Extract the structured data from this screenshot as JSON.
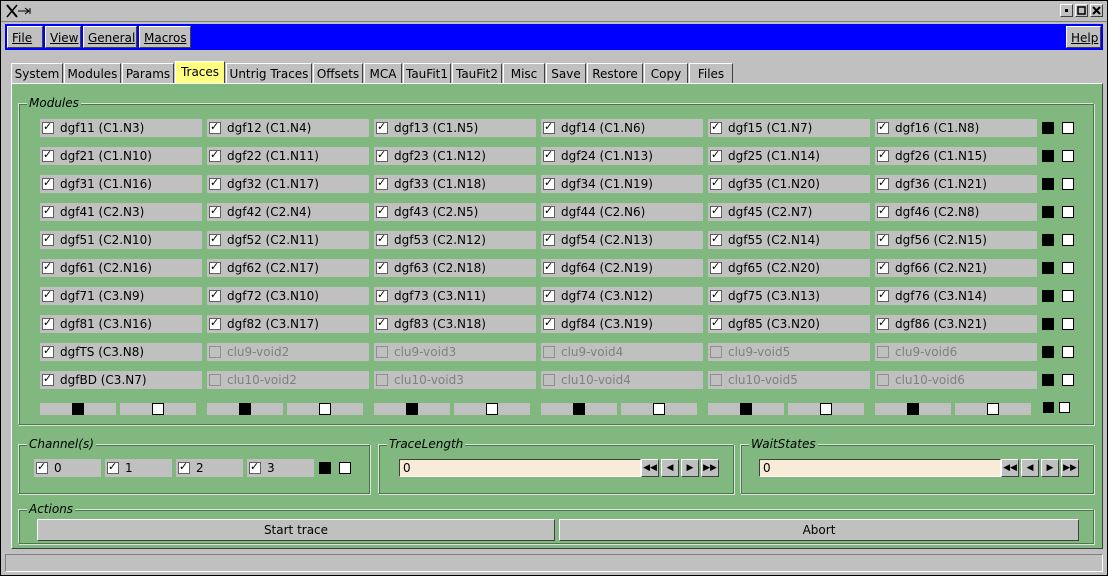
{
  "window": {
    "title_icon": "x-window-icon",
    "controls": [
      "minimize-icon",
      "maximize-icon",
      "close-icon"
    ]
  },
  "menubar": {
    "file": "File",
    "view": "View",
    "general": "General",
    "macros": "Macros",
    "help": "Help"
  },
  "tabs": [
    "System",
    "Modules",
    "Params",
    "Traces",
    "Untrig Traces",
    "Offsets",
    "MCA",
    "TauFit1",
    "TauFit2",
    "Misc",
    "Save",
    "Restore",
    "Copy",
    "Files"
  ],
  "active_tab": "Traces",
  "modules": {
    "title": "Modules",
    "rows": [
      [
        {
          "t": "dgf11 (C1.N3)",
          "c": true,
          "e": true
        },
        {
          "t": "dgf12 (C1.N4)",
          "c": true,
          "e": true
        },
        {
          "t": "dgf13 (C1.N5)",
          "c": true,
          "e": true
        },
        {
          "t": "dgf14 (C1.N6)",
          "c": true,
          "e": true
        },
        {
          "t": "dgf15 (C1.N7)",
          "c": true,
          "e": true
        },
        {
          "t": "dgf16 (C1.N8)",
          "c": true,
          "e": true
        }
      ],
      [
        {
          "t": "dgf21 (C1.N10)",
          "c": true,
          "e": true
        },
        {
          "t": "dgf22 (C1.N11)",
          "c": true,
          "e": true
        },
        {
          "t": "dgf23 (C1.N12)",
          "c": true,
          "e": true
        },
        {
          "t": "dgf24 (C1.N13)",
          "c": true,
          "e": true
        },
        {
          "t": "dgf25 (C1.N14)",
          "c": true,
          "e": true
        },
        {
          "t": "dgf26 (C1.N15)",
          "c": true,
          "e": true
        }
      ],
      [
        {
          "t": "dgf31 (C1.N16)",
          "c": true,
          "e": true
        },
        {
          "t": "dgf32 (C1.N17)",
          "c": true,
          "e": true
        },
        {
          "t": "dgf33 (C1.N18)",
          "c": true,
          "e": true
        },
        {
          "t": "dgf34 (C1.N19)",
          "c": true,
          "e": true
        },
        {
          "t": "dgf35 (C1.N20)",
          "c": true,
          "e": true
        },
        {
          "t": "dgf36 (C1.N21)",
          "c": true,
          "e": true
        }
      ],
      [
        {
          "t": "dgf41 (C2.N3)",
          "c": true,
          "e": true
        },
        {
          "t": "dgf42 (C2.N4)",
          "c": true,
          "e": true
        },
        {
          "t": "dgf43 (C2.N5)",
          "c": true,
          "e": true
        },
        {
          "t": "dgf44 (C2.N6)",
          "c": true,
          "e": true
        },
        {
          "t": "dgf45 (C2.N7)",
          "c": true,
          "e": true
        },
        {
          "t": "dgf46 (C2.N8)",
          "c": true,
          "e": true
        }
      ],
      [
        {
          "t": "dgf51 (C2.N10)",
          "c": true,
          "e": true
        },
        {
          "t": "dgf52 (C2.N11)",
          "c": true,
          "e": true
        },
        {
          "t": "dgf53 (C2.N12)",
          "c": true,
          "e": true
        },
        {
          "t": "dgf54 (C2.N13)",
          "c": true,
          "e": true
        },
        {
          "t": "dgf55 (C2.N14)",
          "c": true,
          "e": true
        },
        {
          "t": "dgf56 (C2.N15)",
          "c": true,
          "e": true
        }
      ],
      [
        {
          "t": "dgf61 (C2.N16)",
          "c": true,
          "e": true
        },
        {
          "t": "dgf62 (C2.N17)",
          "c": true,
          "e": true
        },
        {
          "t": "dgf63 (C2.N18)",
          "c": true,
          "e": true
        },
        {
          "t": "dgf64 (C2.N19)",
          "c": true,
          "e": true
        },
        {
          "t": "dgf65 (C2.N20)",
          "c": true,
          "e": true
        },
        {
          "t": "dgf66 (C2.N21)",
          "c": true,
          "e": true
        }
      ],
      [
        {
          "t": "dgf71 (C3.N9)",
          "c": true,
          "e": true
        },
        {
          "t": "dgf72 (C3.N10)",
          "c": true,
          "e": true
        },
        {
          "t": "dgf73 (C3.N11)",
          "c": true,
          "e": true
        },
        {
          "t": "dgf74 (C3.N12)",
          "c": true,
          "e": true
        },
        {
          "t": "dgf75 (C3.N13)",
          "c": true,
          "e": true
        },
        {
          "t": "dgf76 (C3.N14)",
          "c": true,
          "e": true
        }
      ],
      [
        {
          "t": "dgf81 (C3.N16)",
          "c": true,
          "e": true
        },
        {
          "t": "dgf82 (C3.N17)",
          "c": true,
          "e": true
        },
        {
          "t": "dgf83 (C3.N18)",
          "c": true,
          "e": true
        },
        {
          "t": "dgf84 (C3.N19)",
          "c": true,
          "e": true
        },
        {
          "t": "dgf85 (C3.N20)",
          "c": true,
          "e": true
        },
        {
          "t": "dgf86 (C3.N21)",
          "c": true,
          "e": true
        }
      ],
      [
        {
          "t": "dgfTS (C3.N8)",
          "c": true,
          "e": true
        },
        {
          "t": "clu9-void2",
          "c": false,
          "e": false
        },
        {
          "t": "clu9-void3",
          "c": false,
          "e": false
        },
        {
          "t": "clu9-void4",
          "c": false,
          "e": false
        },
        {
          "t": "clu9-void5",
          "c": false,
          "e": false
        },
        {
          "t": "clu9-void6",
          "c": false,
          "e": false
        }
      ],
      [
        {
          "t": "dgfBD (C3.N7)",
          "c": true,
          "e": true
        },
        {
          "t": "clu10-void2",
          "c": false,
          "e": false
        },
        {
          "t": "clu10-void3",
          "c": false,
          "e": false
        },
        {
          "t": "clu10-void4",
          "c": false,
          "e": false
        },
        {
          "t": "clu10-void5",
          "c": false,
          "e": false
        },
        {
          "t": "clu10-void6",
          "c": false,
          "e": false
        }
      ]
    ]
  },
  "channels": {
    "title": "Channel(s)",
    "items": [
      {
        "t": "0",
        "c": true
      },
      {
        "t": "1",
        "c": true
      },
      {
        "t": "2",
        "c": true
      },
      {
        "t": "3",
        "c": true
      }
    ]
  },
  "trace_length": {
    "title": "TraceLength",
    "value": "0"
  },
  "wait_states": {
    "title": "WaitStates",
    "value": "0"
  },
  "actions": {
    "title": "Actions",
    "start": "Start trace",
    "abort": "Abort"
  },
  "colors": {
    "menubar": "#0000ff",
    "panel": "#80b880",
    "active_tab": "#ffff80",
    "entry": "#f8ecd8"
  }
}
